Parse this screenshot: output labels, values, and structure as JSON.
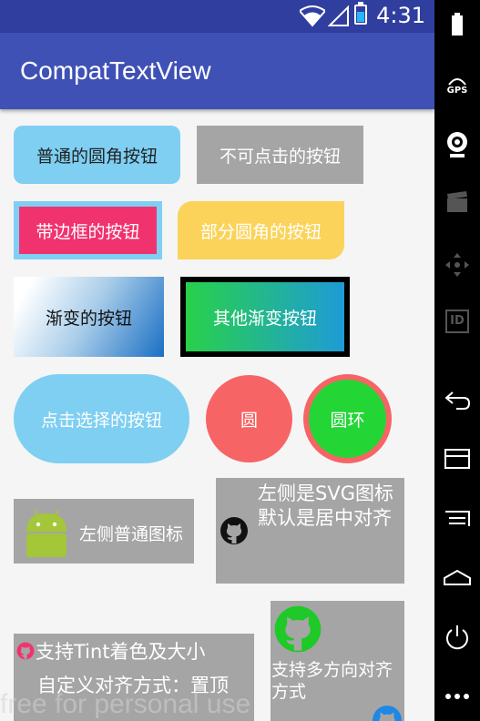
{
  "status_bar": {
    "time": "4:31"
  },
  "app_bar": {
    "title": "CompatTextView"
  },
  "buttons": {
    "rounded": "普通的圆角按钮",
    "disabled": "不可点击的按钮",
    "bordered": "带边框的按钮",
    "partial_round": "部分圆角的按钮",
    "gradient": "渐变的按钮",
    "other_gradient": "其他渐变按钮",
    "selectable": "点击选择的按钮",
    "circle": "圆",
    "ring": "圆环",
    "left_icon": "左侧普通图标",
    "svg_icon": "左侧是SVG图标\n默认是居中对齐",
    "multi_direction": "支持多方向对齐方式",
    "tint_line1": "支持Tint着色及大小",
    "tint_line2": "自定义对齐方式：置顶"
  },
  "watermark": "free for personal use",
  "side_bar": {
    "gps_label": "GPS",
    "id_label": "ID"
  },
  "colors": {
    "primary": "#3f51b5",
    "primary_dark": "#303f9f",
    "sky": "#7ecff2",
    "pink": "#f0336f",
    "yellow": "#fbd35a",
    "red": "#f76466",
    "green": "#23d636",
    "gray": "#a5a5a5"
  }
}
